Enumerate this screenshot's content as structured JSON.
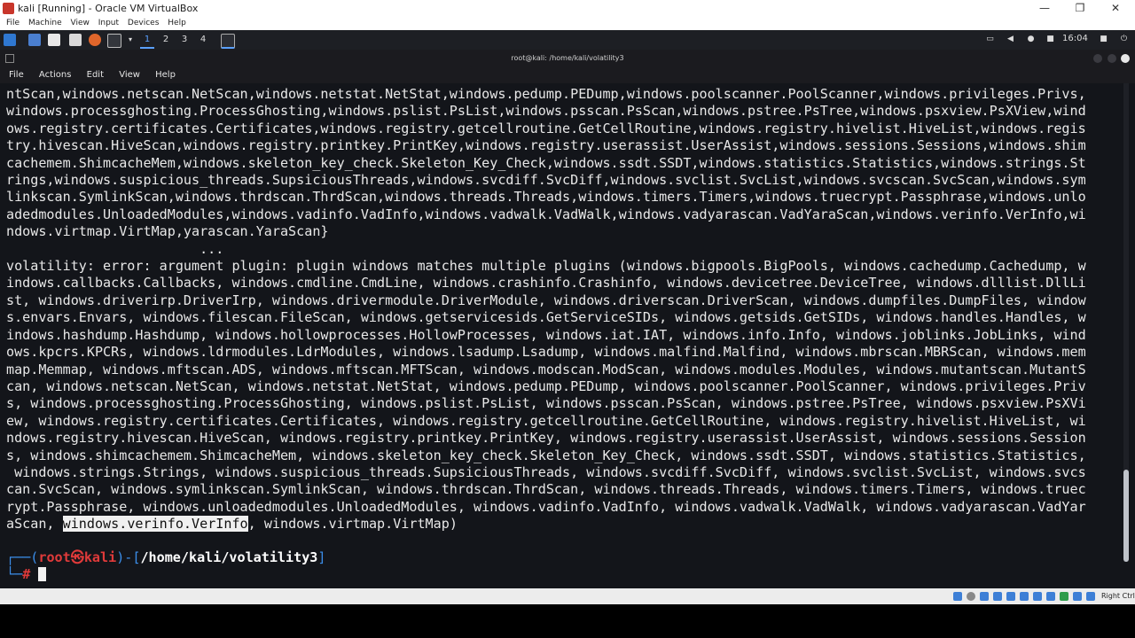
{
  "host_window": {
    "title": "kali [Running] - Oracle VM VirtualBox",
    "minimize": "—",
    "maximize": "❐",
    "close": "✕"
  },
  "vbox_menu": [
    "File",
    "Machine",
    "View",
    "Input",
    "Devices",
    "Help"
  ],
  "kali_panel": {
    "workspaces": [
      "1",
      "2",
      "3",
      "4"
    ],
    "clock": "16:04"
  },
  "terminal": {
    "title": "root@kali: /home/kali/volatility3",
    "menu": [
      "File",
      "Actions",
      "Edit",
      "View",
      "Help"
    ],
    "output_lines": [
      "ntScan,windows.netscan.NetScan,windows.netstat.NetStat,windows.pedump.PEDump,windows.poolscanner.PoolScanner,windows.privileges.Privs,",
      "windows.processghosting.ProcessGhosting,windows.pslist.PsList,windows.psscan.PsScan,windows.pstree.PsTree,windows.psxview.PsXView,wind",
      "ows.registry.certificates.Certificates,windows.registry.getcellroutine.GetCellRoutine,windows.registry.hivelist.HiveList,windows.regis",
      "try.hivescan.HiveScan,windows.registry.printkey.PrintKey,windows.registry.userassist.UserAssist,windows.sessions.Sessions,windows.shim",
      "cachemem.ShimcacheMem,windows.skeleton_key_check.Skeleton_Key_Check,windows.ssdt.SSDT,windows.statistics.Statistics,windows.strings.St",
      "rings,windows.suspicious_threads.SupsiciousThreads,windows.svcdiff.SvcDiff,windows.svclist.SvcList,windows.svcscan.SvcScan,windows.sym",
      "linkscan.SymlinkScan,windows.thrdscan.ThrdScan,windows.threads.Threads,windows.timers.Timers,windows.truecrypt.Passphrase,windows.unlo",
      "adedmodules.UnloadedModules,windows.vadinfo.VadInfo,windows.vadwalk.VadWalk,windows.vadyarascan.VadYaraScan,windows.verinfo.VerInfo,wi",
      "ndows.virtmap.VirtMap,yarascan.YaraScan}",
      "                        ...",
      "volatility: error: argument plugin: plugin windows matches multiple plugins (windows.bigpools.BigPools, windows.cachedump.Cachedump, w",
      "indows.callbacks.Callbacks, windows.cmdline.CmdLine, windows.crashinfo.Crashinfo, windows.devicetree.DeviceTree, windows.dlllist.DllLi",
      "st, windows.driverirp.DriverIrp, windows.drivermodule.DriverModule, windows.driverscan.DriverScan, windows.dumpfiles.DumpFiles, window",
      "s.envars.Envars, windows.filescan.FileScan, windows.getservicesids.GetServiceSIDs, windows.getsids.GetSIDs, windows.handles.Handles, w",
      "indows.hashdump.Hashdump, windows.hollowprocesses.HollowProcesses, windows.iat.IAT, windows.info.Info, windows.joblinks.JobLinks, wind",
      "ows.kpcrs.KPCRs, windows.ldrmodules.LdrModules, windows.lsadump.Lsadump, windows.malfind.Malfind, windows.mbrscan.MBRScan, windows.mem",
      "map.Memmap, windows.mftscan.ADS, windows.mftscan.MFTScan, windows.modscan.ModScan, windows.modules.Modules, windows.mutantscan.MutantS",
      "can, windows.netscan.NetScan, windows.netstat.NetStat, windows.pedump.PEDump, windows.poolscanner.PoolScanner, windows.privileges.Priv",
      "s, windows.processghosting.ProcessGhosting, windows.pslist.PsList, windows.psscan.PsScan, windows.pstree.PsTree, windows.psxview.PsXVi",
      "ew, windows.registry.certificates.Certificates, windows.registry.getcellroutine.GetCellRoutine, windows.registry.hivelist.HiveList, wi",
      "ndows.registry.hivescan.HiveScan, windows.registry.printkey.PrintKey, windows.registry.userassist.UserAssist, windows.sessions.Session",
      "s, windows.shimcachemem.ShimcacheMem, windows.skeleton_key_check.Skeleton_Key_Check, windows.ssdt.SSDT, windows.statistics.Statistics,",
      " windows.strings.Strings, windows.suspicious_threads.SupsiciousThreads, windows.svcdiff.SvcDiff, windows.svclist.SvcList, windows.svcs",
      "can.SvcScan, windows.symlinkscan.SymlinkScan, windows.thrdscan.ThrdScan, windows.threads.Threads, windows.timers.Timers, windows.truec",
      "rypt.Passphrase, windows.unloadedmodules.UnloadedModules, windows.vadinfo.VadInfo, windows.vadwalk.VadWalk, windows.vadyarascan.VadYar"
    ],
    "last_line_prefix": "aScan, ",
    "selected_text": "windows.verinfo.VerInfo",
    "last_line_suffix": ", windows.virtmap.VirtMap)",
    "prompt": {
      "corner_top": "┌──(",
      "user": "root",
      "at": "㉿",
      "host": "kali",
      "mid": ")-[",
      "path": "/home/kali/volatility3",
      "end": "]",
      "corner_bottom": "└─",
      "symbol": "# "
    }
  },
  "status_bar": {
    "host_key": "Right Ctrl"
  },
  "colors": {
    "terminal_bg": "#13151a",
    "prompt_blue": "#3b8eea",
    "prompt_red": "#e03a3a"
  }
}
